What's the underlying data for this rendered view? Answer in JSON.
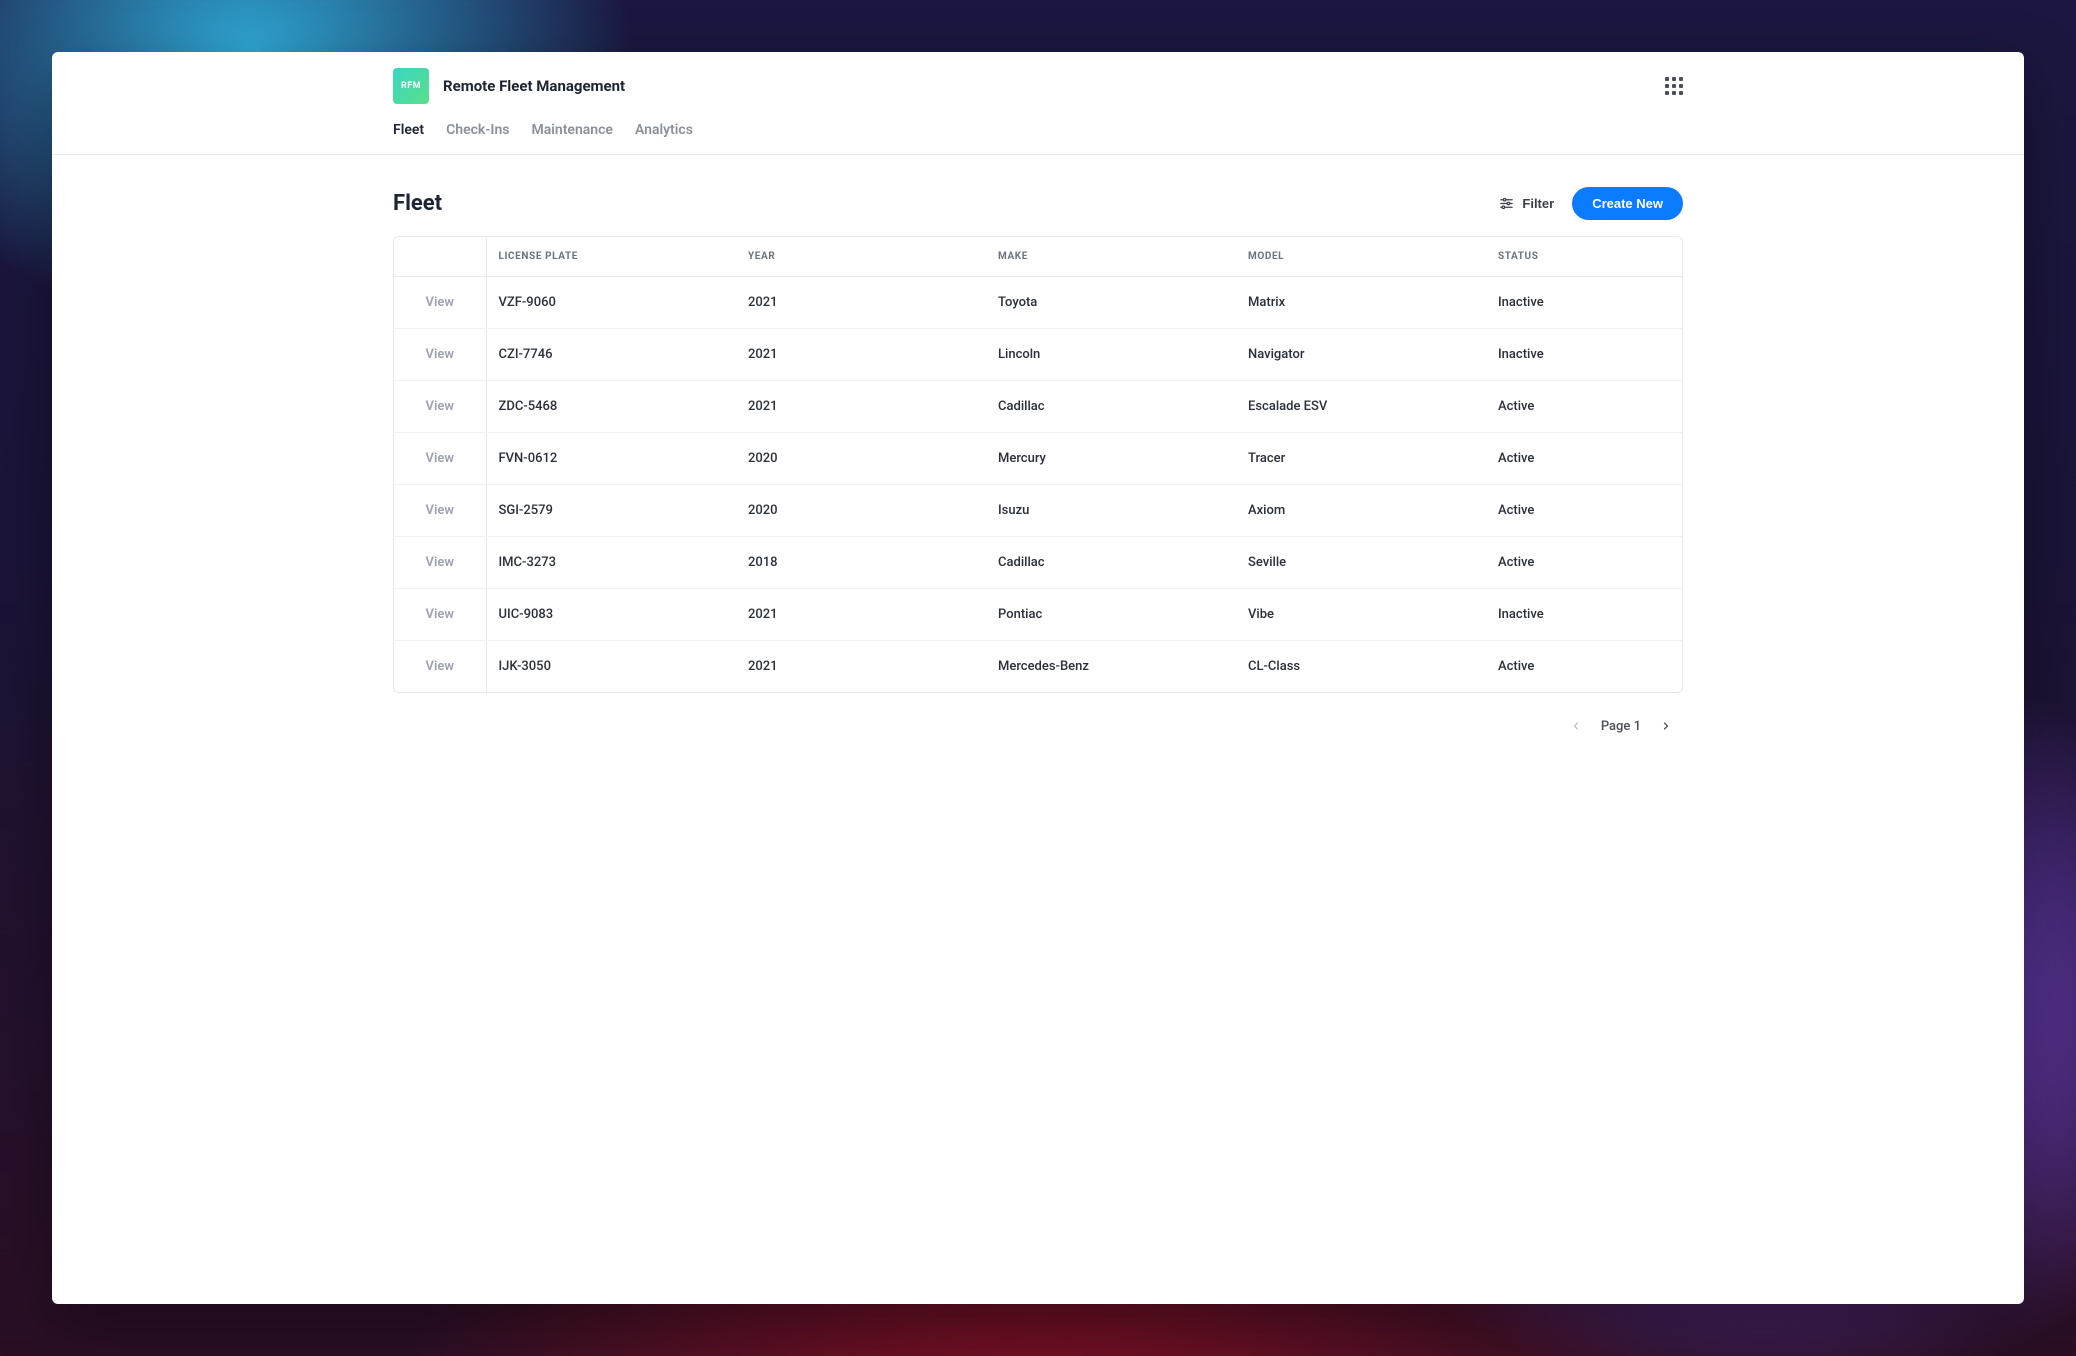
{
  "brand": {
    "logo_text": "RFM",
    "title": "Remote Fleet Management"
  },
  "tabs": [
    {
      "label": "Fleet",
      "active": true
    },
    {
      "label": "Check-Ins",
      "active": false
    },
    {
      "label": "Maintenance",
      "active": false
    },
    {
      "label": "Analytics",
      "active": false
    }
  ],
  "page": {
    "title": "Fleet",
    "filter_label": "Filter",
    "create_label": "Create New"
  },
  "table": {
    "view_label": "View",
    "columns": {
      "plate": "License Plate",
      "year": "Year",
      "make": "Make",
      "model": "Model",
      "status": "Status"
    },
    "rows": [
      {
        "plate": "VZF-9060",
        "year": "2021",
        "make": "Toyota",
        "model": "Matrix",
        "status": "Inactive"
      },
      {
        "plate": "CZI-7746",
        "year": "2021",
        "make": "Lincoln",
        "model": "Navigator",
        "status": "Inactive"
      },
      {
        "plate": "ZDC-5468",
        "year": "2021",
        "make": "Cadillac",
        "model": "Escalade ESV",
        "status": "Active"
      },
      {
        "plate": "FVN-0612",
        "year": "2020",
        "make": "Mercury",
        "model": "Tracer",
        "status": "Active"
      },
      {
        "plate": "SGI-2579",
        "year": "2020",
        "make": "Isuzu",
        "model": "Axiom",
        "status": "Active"
      },
      {
        "plate": "IMC-3273",
        "year": "2018",
        "make": "Cadillac",
        "model": "Seville",
        "status": "Active"
      },
      {
        "plate": "UIC-9083",
        "year": "2021",
        "make": "Pontiac",
        "model": "Vibe",
        "status": "Inactive"
      },
      {
        "plate": "IJK-3050",
        "year": "2021",
        "make": "Mercedes-Benz",
        "model": "CL-Class",
        "status": "Active"
      }
    ]
  },
  "pagination": {
    "label": "Page 1",
    "prev_enabled": false,
    "next_enabled": true
  },
  "colors": {
    "accent": "#0b7bff"
  }
}
